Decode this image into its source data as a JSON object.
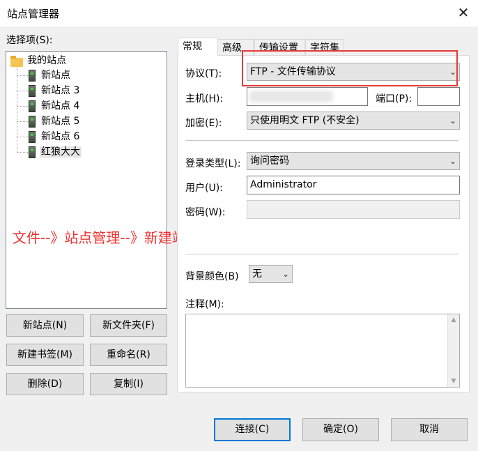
{
  "window": {
    "title": "站点管理器",
    "close_glyph": "✕"
  },
  "select_label": "选择项(S):",
  "tree": {
    "root": "我的站点",
    "items": [
      "新站点",
      "新站点 3",
      "新站点 4",
      "新站点 5",
      "新站点 6",
      "红狼大大"
    ],
    "selected_index": 5
  },
  "left_buttons": {
    "new_site": "新站点(N)",
    "new_folder": "新文件夹(F)",
    "new_bookmark": "新建书签(M)",
    "rename": "重命名(R)",
    "delete": "删除(D)",
    "copy": "复制(I)"
  },
  "tabs": [
    "常规",
    "高级",
    "传输设置",
    "字符集"
  ],
  "general": {
    "protocol_label": "协议(T):",
    "protocol_value": "FTP - 文件传输协议",
    "host_label": "主机(H):",
    "host_value": "",
    "port_label": "端口(P):",
    "port_value": "",
    "encryption_label": "加密(E):",
    "encryption_value": "只使用明文 FTP (不安全)",
    "logon_type_label": "登录类型(L):",
    "logon_type_value": "询问密码",
    "user_label": "用户(U):",
    "user_value": "Administrator",
    "password_label": "密码(W):",
    "bg_color_label": "背景颜色(B)",
    "bg_color_value": "无",
    "comments_label": "注释(M):"
  },
  "annotation": "文件--》站点管理--》新建站点",
  "bottom_buttons": {
    "connect": "连接(C)",
    "ok": "确定(O)",
    "cancel": "取消"
  },
  "colors": {
    "annotation_red": "#e53935",
    "selection_accent": "#0078d7"
  }
}
